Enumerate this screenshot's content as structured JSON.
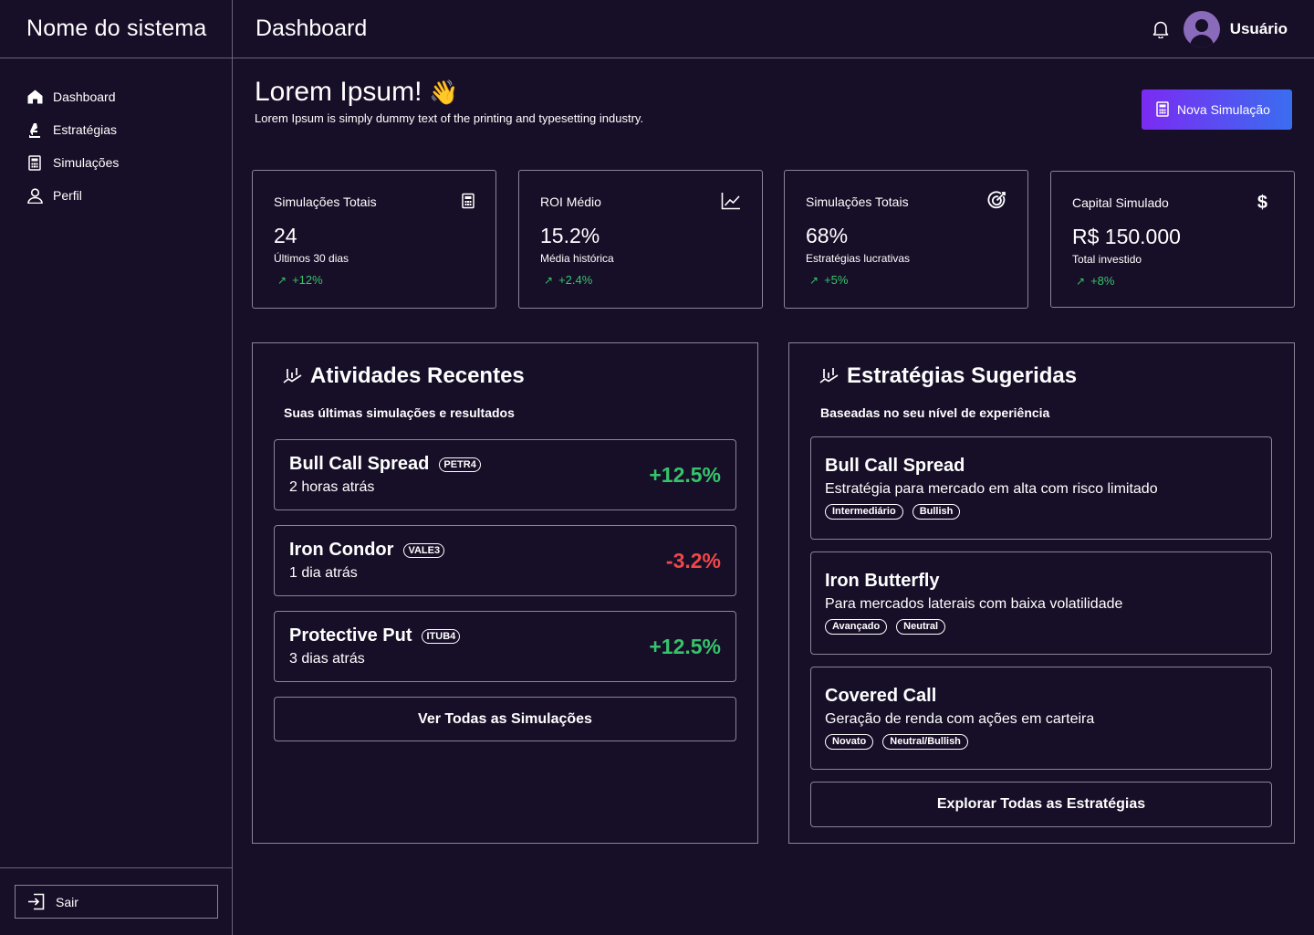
{
  "header": {
    "brand": "Nome do sistema",
    "page_title": "Dashboard",
    "user_name": "Usuário"
  },
  "sidebar": {
    "items": [
      {
        "label": "Dashboard",
        "icon": "home-icon"
      },
      {
        "label": "Estratégias",
        "icon": "chess-piece-icon"
      },
      {
        "label": "Simulações",
        "icon": "calculator-icon"
      },
      {
        "label": "Perfil",
        "icon": "user-icon"
      }
    ],
    "logout_label": "Sair"
  },
  "greeting": {
    "title": "Lorem Ipsum!",
    "emoji": "👋",
    "subtitle": "Lorem Ipsum is simply dummy text of the printing and typesetting industry."
  },
  "new_simulation_label": "Nova Simulação",
  "stats": [
    {
      "title": "Simulações Totais",
      "value": "24",
      "note": "Últimos 30 dias",
      "trend": "+12%",
      "icon": "calculator-icon"
    },
    {
      "title": "ROI Médio",
      "value": "15.2%",
      "note": "Média histórica",
      "trend": "+2.4%",
      "icon": "line-chart-icon"
    },
    {
      "title": "Simulações Totais",
      "value": "68%",
      "note": "Estratégias lucrativas",
      "trend": "+5%",
      "icon": "target-icon"
    },
    {
      "title": "Capital Simulado",
      "value": "R$ 150.000",
      "note": "Total investido",
      "trend": "+8%",
      "icon": "dollar-icon"
    }
  ],
  "recent": {
    "title": "Atividades Recentes",
    "subtitle": "Suas últimas simulações e resultados",
    "items": [
      {
        "name": "Bull Call Spread",
        "ticker": "PETR4",
        "time": "2 horas atrás",
        "pct": "+12.5%"
      },
      {
        "name": "Iron Condor",
        "ticker": "VALE3",
        "time": "1 dia atrás",
        "pct": "-3.2%"
      },
      {
        "name": "Protective Put",
        "ticker": "ITUB4",
        "time": "3 dias atrás",
        "pct": "+12.5%"
      }
    ],
    "button": "Ver Todas as Simulações"
  },
  "suggested": {
    "title": "Estratégias Sugeridas",
    "subtitle": "Baseadas no seu nível de experiência",
    "items": [
      {
        "name": "Bull Call Spread",
        "desc": "Estratégia para mercado em alta com risco limitado",
        "tags": [
          "Intermediário",
          "Bullish"
        ]
      },
      {
        "name": "Iron Butterfly",
        "desc": "Para mercados laterais com baixa volatilidade",
        "tags": [
          "Avançado",
          "Neutral"
        ]
      },
      {
        "name": "Covered Call",
        "desc": "Geração de renda com ações em carteira",
        "tags": [
          "Novato",
          "Neutral/Bullish"
        ]
      }
    ],
    "button": "Explorar Todas as Estratégias"
  },
  "colors": {
    "background": "#170e27",
    "border": "#8c8497",
    "positive": "#35c46a",
    "negative": "#ef4848",
    "accent_start": "#7b2bf2",
    "accent_end": "#3a6df0"
  }
}
